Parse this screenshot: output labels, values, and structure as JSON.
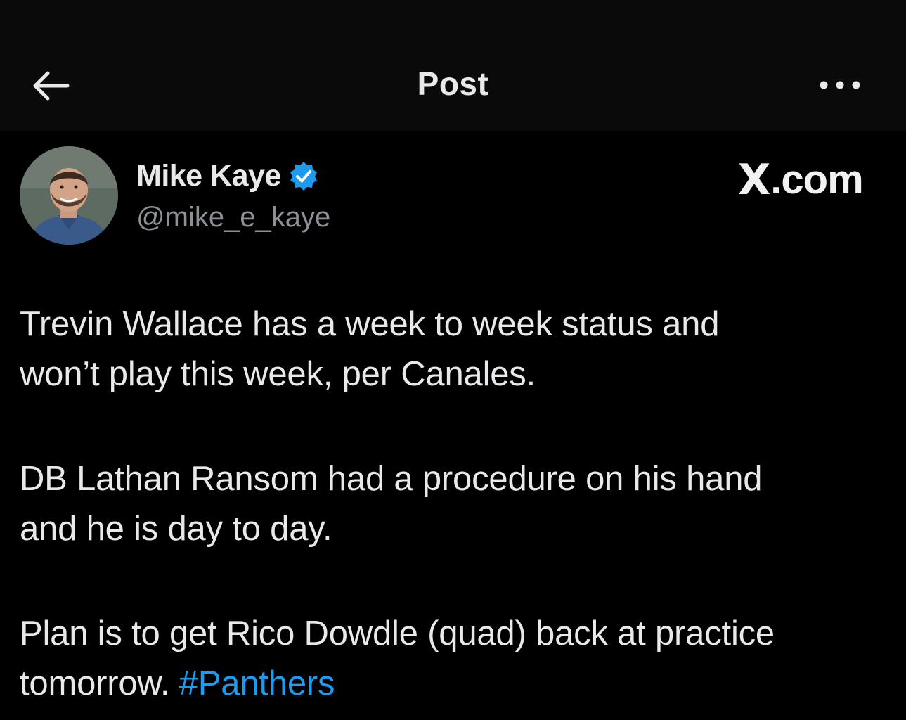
{
  "header": {
    "title": "Post",
    "back_icon": "arrow-left-icon",
    "more_icon": "more-horizontal-icon",
    "background": "#0a0a0a"
  },
  "author": {
    "name": "Mike Kaye",
    "handle": "@mike_e_kaye",
    "verified": true,
    "verified_color": "#1d9bf0"
  },
  "watermark": {
    "logo": "X",
    "domain": ".com"
  },
  "post": {
    "paragraphs": [
      {
        "line1": "Trevin Wallace has a week to week status and",
        "line2": "won’t play this week, per Canales."
      },
      {
        "line1": "DB Lathan Ransom had a procedure on his hand",
        "line2": "and he is day to day."
      },
      {
        "line1": "Plan is to get Rico Dowdle (quad) back at practice",
        "line2_prefix": "tomorrow. ",
        "hashtag": "#Panthers"
      }
    ],
    "link_color": "#1d9bf0",
    "text_color": "#e7e9ea"
  }
}
